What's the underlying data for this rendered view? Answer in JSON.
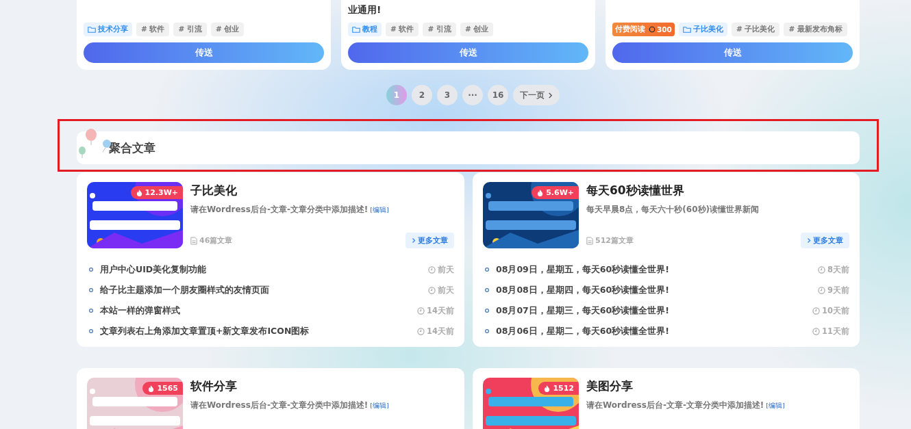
{
  "top_cards": [
    {
      "category": "技术分享",
      "tags": [
        "# 软件",
        "# 引流",
        "# 创业"
      ],
      "button": "传送"
    },
    {
      "title_tail": "业通用!",
      "category": "教程",
      "tags": [
        "# 软件",
        "# 引流",
        "# 创业"
      ],
      "button": "传送"
    },
    {
      "paid": {
        "label": "付费阅读",
        "price": "300"
      },
      "category": "子比美化",
      "tags": [
        "# 子比美化",
        "# 最新发布角标"
      ],
      "button": "传送"
    }
  ],
  "pagination": {
    "pages": [
      {
        "label": "1",
        "selected": true
      },
      {
        "label": "2",
        "selected": false
      },
      {
        "label": "3",
        "selected": false
      },
      {
        "label": "···",
        "selected": false
      },
      {
        "label": "16",
        "selected": false
      }
    ],
    "next": "下一页"
  },
  "section": {
    "title": "聚合文章"
  },
  "categories": [
    {
      "name": "子比美化",
      "badge": "12.3W+",
      "description": "请在Wordress后台-文章-文章分类中添加描述!",
      "edit": "[编辑]",
      "count": "46篇文章",
      "more": "更多文章",
      "posts": [
        {
          "title": "用户中心UID美化复制功能",
          "time": "前天"
        },
        {
          "title": "给子比主题添加一个朋友圈样式的友情页面",
          "time": "前天"
        },
        {
          "title": "本站一样的弹窗样式",
          "time": "14天前"
        },
        {
          "title": "文章列表右上角添加文章置顶+新文章发布ICON图标",
          "time": "14天前"
        }
      ]
    },
    {
      "name": "每天60秒读懂世界",
      "badge": "5.6W+",
      "description": "每天早晨8点，每天六十秒(60秒)读懂世界新闻",
      "count": "512篇文章",
      "more": "更多文章",
      "posts": [
        {
          "title": "08月09日，星期五，每天60秒读懂全世界!",
          "time": "8天前"
        },
        {
          "title": "08月08日，星期四，每天60秒读懂全世界!",
          "time": "9天前"
        },
        {
          "title": "08月07日，星期三，每天60秒读懂全世界!",
          "time": "10天前"
        },
        {
          "title": "08月06日，星期二，每天60秒读懂全世界!",
          "time": "11天前"
        }
      ]
    },
    {
      "name": "软件分享",
      "badge": "1565",
      "description": "请在Wordress后台-文章-文章分类中添加描述!",
      "edit": "[编辑]"
    },
    {
      "name": "美图分享",
      "badge": "1512",
      "description": "请在Wordress后台-文章-文章分类中添加描述!",
      "edit": "[编辑]"
    }
  ]
}
